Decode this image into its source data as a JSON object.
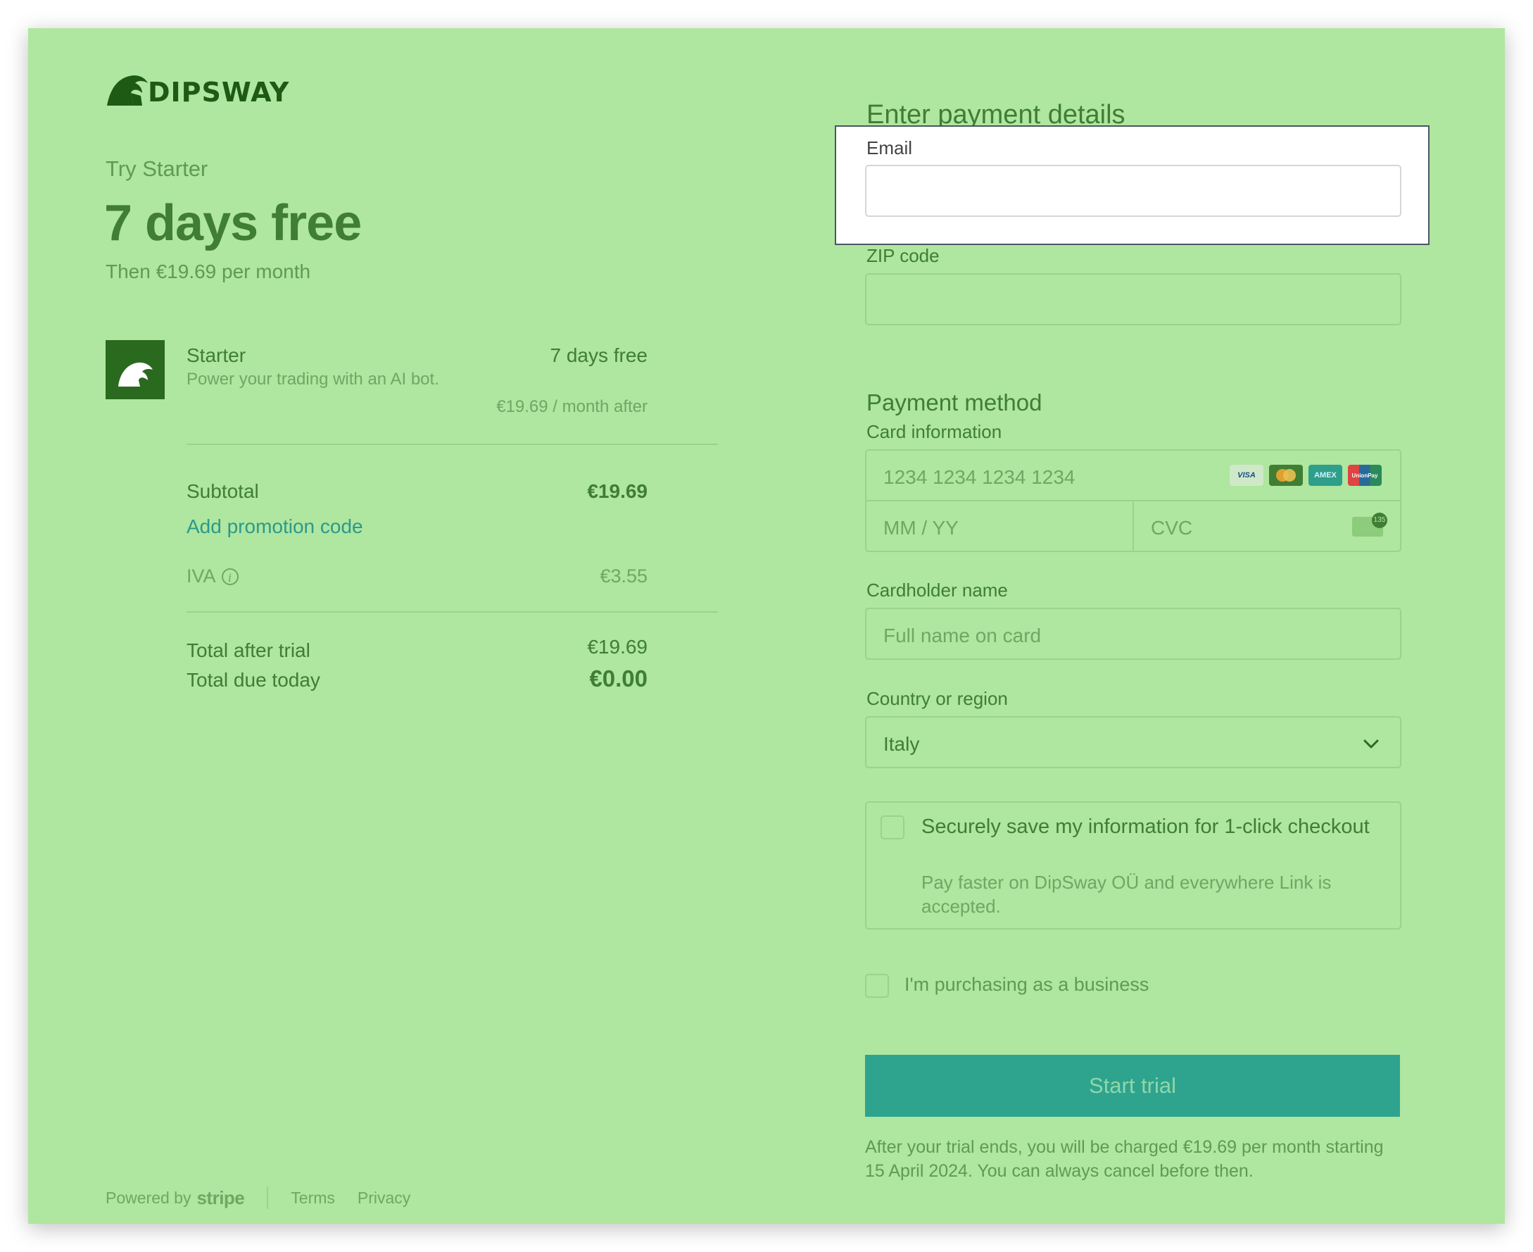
{
  "brand": {
    "name": "DIPSWAY"
  },
  "summary": {
    "try_label": "Try Starter",
    "headline": "7 days free",
    "then_text": "Then €19.69 per month",
    "product": {
      "name": "Starter",
      "description": "Power your trading with an AI bot.",
      "trial": "7 days free",
      "price_after": "€19.69 / month after"
    },
    "subtotal_label": "Subtotal",
    "subtotal_value": "€19.69",
    "promo_label": "Add promotion code",
    "tax_label": "IVA",
    "tax_value": "€3.55",
    "total_after_label": "Total after trial",
    "total_after_value": "€19.69",
    "total_due_label": "Total due today",
    "total_due_value": "€0.00"
  },
  "footer": {
    "powered_by": "Powered by",
    "stripe": "stripe",
    "terms": "Terms",
    "privacy": "Privacy"
  },
  "payment": {
    "heading": "Enter payment details",
    "email_label": "Email",
    "email_value": "",
    "zip_label": "ZIP code",
    "zip_value": "",
    "method_heading": "Payment method",
    "card_label": "Card information",
    "card_number_placeholder": "1234 1234 1234 1234",
    "expiry_placeholder": "MM / YY",
    "cvc_placeholder": "CVC",
    "card_brands": [
      "VISA",
      "mastercard",
      "AMEX",
      "UnionPay"
    ],
    "cardholder_label": "Cardholder name",
    "cardholder_placeholder": "Full name on card",
    "country_label": "Country or region",
    "country_value": "Italy",
    "save_title": "Securely save my information for 1-click checkout",
    "save_subtitle": "Pay faster on DipSway OÜ and everywhere Link is accepted.",
    "business_label": "I'm purchasing as a business",
    "submit_label": "Start trial",
    "disclaimer": "After your trial ends, you will be charged €19.69 per month starting 15 April 2024. You can always cancel before then."
  },
  "colors": {
    "overlay_green": "#afe6a0",
    "dark_green": "#2a6a1e",
    "accent_teal": "#2ea48f"
  }
}
